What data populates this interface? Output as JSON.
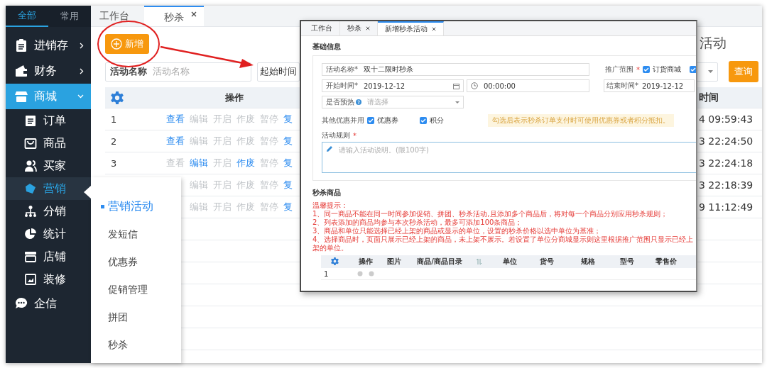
{
  "sidebar": {
    "tabs": [
      {
        "label": "全部",
        "selected": true
      },
      {
        "label": "常用",
        "selected": false
      }
    ],
    "items": [
      {
        "label": "进销存",
        "kind": "group",
        "expanded": false,
        "selected": false
      },
      {
        "label": "财务",
        "kind": "group",
        "expanded": false,
        "selected": false
      },
      {
        "label": "商城",
        "kind": "group",
        "expanded": true,
        "selected": true,
        "children": [
          {
            "label": "订单",
            "selected": false
          },
          {
            "label": "商品",
            "selected": false
          },
          {
            "label": "买家",
            "selected": false
          },
          {
            "label": "营销",
            "selected": true
          },
          {
            "label": "分销",
            "selected": false
          },
          {
            "label": "统计",
            "selected": false
          },
          {
            "label": "店铺",
            "selected": false
          },
          {
            "label": "装修",
            "selected": false
          }
        ]
      },
      {
        "label": "企信",
        "kind": "link",
        "selected": false
      }
    ]
  },
  "tabs": [
    {
      "label": "工作台",
      "selected": false,
      "closable": false
    },
    {
      "label": "秒杀",
      "selected": true,
      "closable": true
    }
  ],
  "toolbar": {
    "add_button": "新增",
    "page_title": "活动"
  },
  "filters": {
    "name_label": "活动名称",
    "name_placeholder": "活动名称",
    "start_label": "起始时间",
    "query_button": "查询"
  },
  "table": {
    "action_header": "操作",
    "time_header": "时间",
    "rows": [
      {
        "number": "1",
        "actions": [
          {
            "label": "查看",
            "enabled": true
          },
          {
            "label": "编辑",
            "enabled": false
          },
          {
            "label": "开启",
            "enabled": false
          },
          {
            "label": "作废",
            "enabled": false
          },
          {
            "label": "暂停",
            "enabled": false
          },
          {
            "label": "复",
            "enabled": true
          }
        ],
        "time": "4 09:59:43"
      },
      {
        "number": "2",
        "actions": [
          {
            "label": "查看",
            "enabled": true
          },
          {
            "label": "编辑",
            "enabled": false
          },
          {
            "label": "开启",
            "enabled": false
          },
          {
            "label": "作废",
            "enabled": false
          },
          {
            "label": "暂停",
            "enabled": false
          },
          {
            "label": "复",
            "enabled": true
          }
        ],
        "time": "3 22:24:50"
      },
      {
        "number": "3",
        "actions": [
          {
            "label": "查看",
            "enabled": false
          },
          {
            "label": "编辑",
            "enabled": true
          },
          {
            "label": "开启",
            "enabled": false
          },
          {
            "label": "作废",
            "enabled": true
          },
          {
            "label": "暂停",
            "enabled": false
          },
          {
            "label": "复",
            "enabled": true
          }
        ],
        "time": "3 22:24:18"
      },
      {
        "actions": [
          {
            "label": "编辑",
            "enabled": false
          },
          {
            "label": "开启",
            "enabled": false
          },
          {
            "label": "作废",
            "enabled": false
          },
          {
            "label": "暂停",
            "enabled": false
          },
          {
            "label": "复",
            "enabled": true
          }
        ],
        "time": "3 22:18:39"
      },
      {
        "actions": [
          {
            "label": "编辑",
            "enabled": false
          },
          {
            "label": "开启",
            "enabled": false
          },
          {
            "label": "作废",
            "enabled": false
          },
          {
            "label": "暂停",
            "enabled": false
          },
          {
            "label": "复",
            "enabled": true
          }
        ],
        "time": "9 11:12:49"
      }
    ]
  },
  "flyout_menu": {
    "items": [
      {
        "label": "营销活动",
        "selected": true
      },
      {
        "label": "发短信",
        "selected": false
      },
      {
        "label": "优惠券",
        "selected": false
      },
      {
        "label": "促销管理",
        "selected": false
      },
      {
        "label": "拼团",
        "selected": false
      },
      {
        "label": "秒杀",
        "selected": false
      }
    ]
  },
  "inset_window": {
    "tabs": [
      {
        "label": "工作台",
        "selected": false,
        "closable": false
      },
      {
        "label": "秒杀",
        "selected": false,
        "closable": true
      },
      {
        "label": "新增秒杀活动",
        "selected": true,
        "closable": true
      }
    ],
    "basic_title": "基础信息",
    "name_field": {
      "label": "活动名称*",
      "value": "双十二限时秒杀"
    },
    "scope": {
      "label": "推广范围",
      "mark": "*",
      "options": [
        {
          "label": "订货商城",
          "checked": true
        },
        {
          "checked": true
        }
      ]
    },
    "start_date": {
      "label": "开始时间*",
      "value": "2019-12-12"
    },
    "start_time": {
      "value": "00:00:00"
    },
    "end_date": {
      "label": "结束时间*",
      "value": "2019-12-12"
    },
    "preheat": {
      "label": "是否预热",
      "placeholder": "请选择"
    },
    "combine": {
      "label": "其他优惠并用",
      "options": [
        {
          "label": "优惠券",
          "checked": true
        },
        {
          "label": "积分",
          "checked": true
        }
      ],
      "hint": "勾选后表示秒杀订单支付时可使用优惠券或者积分抵扣。"
    },
    "rules": {
      "label": "活动规则",
      "mark": "*",
      "placeholder": "请输入活动说明。(限100字)"
    },
    "goods_title": "秒杀商品",
    "notes_title": "温馨提示：",
    "notes": [
      "1、同一商品不能在同一时间参加促销、拼团、秒杀活动,且添加多个商品后，将对每一个商品分别应用秒杀规则；",
      "2、列表添加的商品均参与本次秒杀活动，最多可添加100条商品；",
      "3、商品和单位只能选择已经上架的商品或显示的单位，设置的秒杀价格以选中单位为基准；",
      "4、选择商品时，页面只展示已经上架的商品，未上架不展示。若设置了单位分商城显示则这里根据推广范围只显示已经上架的单位。"
    ],
    "goods_table": {
      "columns": [
        "操作",
        "图片",
        "商品/商品目录",
        "单位",
        "货号",
        "规格",
        "型号",
        "零售价"
      ],
      "rows": [
        {
          "number": "1"
        }
      ]
    }
  }
}
